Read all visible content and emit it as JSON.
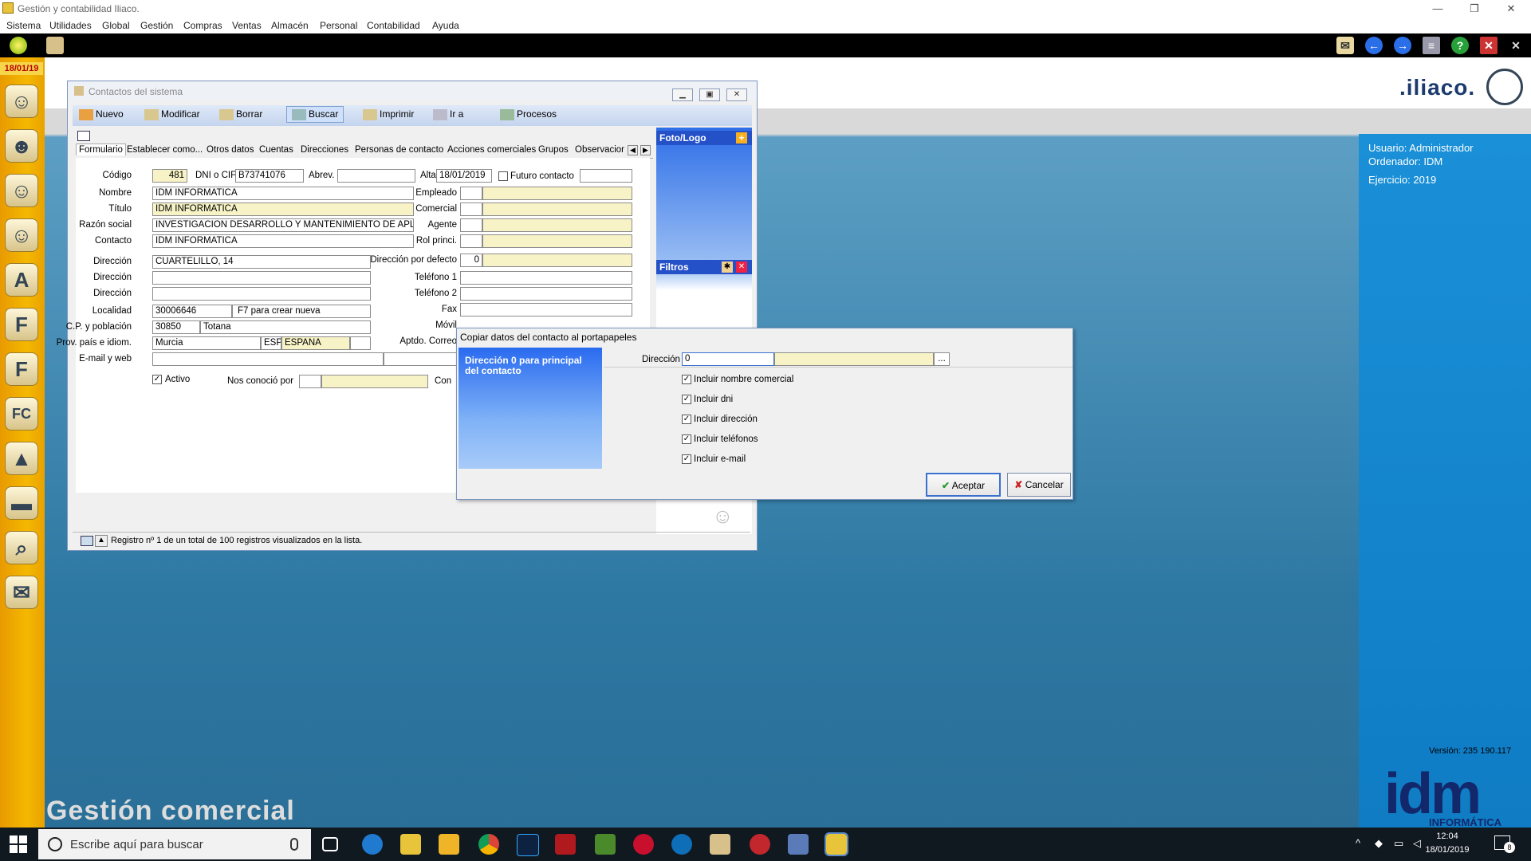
{
  "app": {
    "title": "Gestión y contabilidad Iliaco.",
    "menu": [
      "Sistema",
      "Utilidades",
      "Global",
      "Gestión",
      "Compras",
      "Ventas",
      "Almacén",
      "Personal",
      "Contabilidad",
      "Ayuda"
    ],
    "date_badge": "18/01/19",
    "left_icons": [
      "A",
      "F",
      "F",
      "FC"
    ],
    "bottom_title": "Gestión comercial",
    "logo_text": ".iliaco."
  },
  "info_panel": {
    "usuario": "Usuario: Administrador",
    "ordenador": "Ordenador: IDM",
    "ejercicio": "Ejercicio: 2019",
    "version": "Versión: 235 190.117",
    "brand": "idm",
    "brand_sub": "INFORMÁTICA"
  },
  "contacts_window": {
    "title": "Contactos del sistema",
    "toolbar": [
      "Nuevo",
      "Modificar",
      "Borrar",
      "Buscar",
      "Imprimir",
      "Ir a",
      "Procesos"
    ],
    "tabs": [
      "Formulario",
      "Establecer como...",
      "Otros datos",
      "Cuentas",
      "Direcciones",
      "Personas de contacto",
      "Acciones comerciales",
      "Grupos",
      "Observacion"
    ],
    "labels": {
      "codigo": "Código",
      "dni": "DNI o CIF",
      "abrev": "Abrev.",
      "alta": "Alta",
      "futuro": "Futuro contacto",
      "nombre": "Nombre",
      "titulo": "Título",
      "razon": "Razón social",
      "contacto": "Contacto",
      "empleado": "Empleado",
      "comercial": "Comercial",
      "agente": "Agente",
      "rol": "Rol princi.",
      "direccion": "Dirección",
      "dir_defecto": "Dirección por defecto",
      "telefono1": "Teléfono 1",
      "telefono2": "Teléfono 2",
      "fax": "Fax",
      "movil": "Móvil",
      "aptdo": "Aptdo. Correo",
      "localidad": "Localidad",
      "cp": "C.P. y población",
      "prov": "Prov. país e idiom.",
      "email": "E-mail y web",
      "activo": "Activo",
      "nos_conocio": "Nos conoció por",
      "con": "Con"
    },
    "values": {
      "codigo": "481",
      "dni": "B73741076",
      "alta": "18/01/2019",
      "nombre": "IDM INFORMATICA",
      "titulo": "IDM INFORMATICA",
      "razon": "INVESTIGACION DESARROLLO Y MANTENIMIENTO DE APLICACIONES",
      "contacto": "IDM INFORMATICA",
      "direccion1": "CUARTELILLO, 14",
      "dir_defecto": "0",
      "localidad_code": "30006646",
      "localidad_hint": "F7 para crear nueva",
      "cp": "30850",
      "poblacion": "Totana",
      "provincia": "Murcia",
      "pais_code": "ESP",
      "pais": "ESPANA"
    },
    "side_panel": {
      "foto": "Foto/Logo",
      "filtros": "Filtros"
    },
    "status": "Registro nº 1 de un total de 100 registros visualizados en la lista."
  },
  "dialog": {
    "title": "Copiar datos del contacto al portapapeles",
    "side_text": "Dirección 0 para principal del contacto",
    "direccion_label": "Dirección",
    "direccion_value": "0",
    "options": [
      "Incluir nombre comercial",
      "Incluir dni",
      "Incluir dirección",
      "Incluir teléfonos",
      "Incluir e-mail"
    ],
    "accept": "Aceptar",
    "cancel": "Cancelar"
  },
  "taskbar": {
    "search_placeholder": "Escribe aquí para buscar",
    "time": "12:04",
    "date": "18/01/2019",
    "notif_count": "8"
  }
}
